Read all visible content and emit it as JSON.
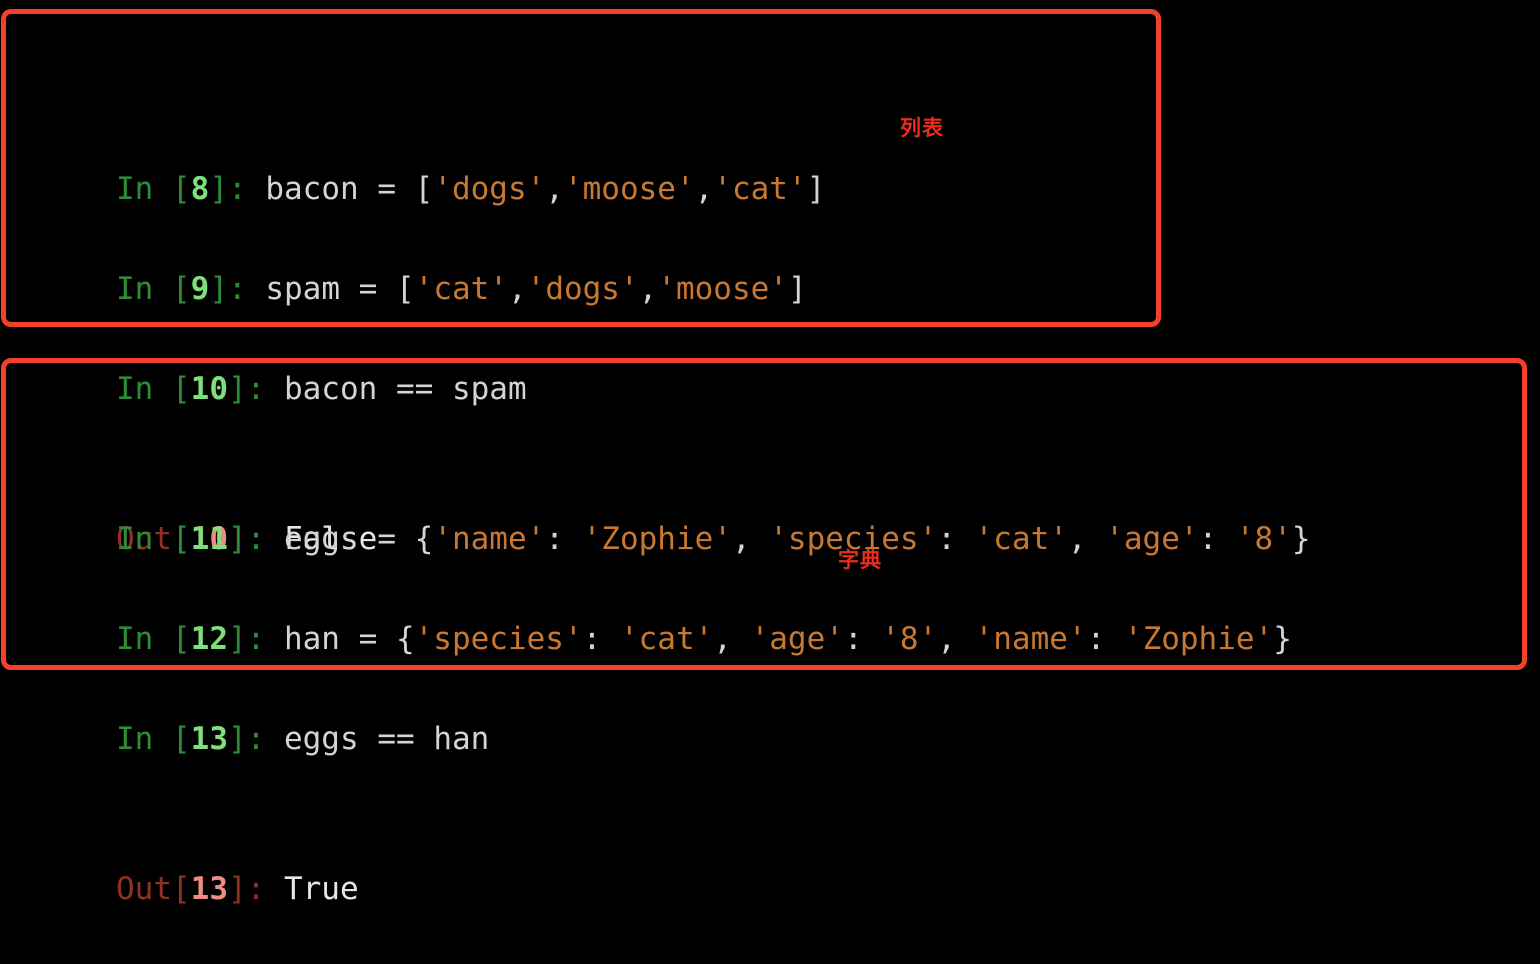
{
  "terminal": {
    "background": "#000000",
    "prompt_in_color": "#2e8b37",
    "prompt_in_num_color": "#7ee07a",
    "prompt_out_color": "#8e3223",
    "prompt_out_num_color": "#f08a84",
    "string_color": "#c87830",
    "punctuation_color": "#d4d4d4",
    "annotation_color": "#ee2b1c",
    "box_border_color": "#f2402a"
  },
  "cells": {
    "c8": {
      "prompt_label": "In ",
      "bracket_open": "[",
      "number": "8",
      "bracket_close": "]: ",
      "var": "bacon ",
      "op": "= ",
      "open": "[",
      "s1": "'dogs'",
      "comma1": ",",
      "s2": "'moose'",
      "comma2": ",",
      "s3": "'cat'",
      "close": "]"
    },
    "c9": {
      "prompt_label": "In ",
      "bracket_open": "[",
      "number": "9",
      "bracket_close": "]: ",
      "var": "spam ",
      "op": "= ",
      "open": "[",
      "s1": "'cat'",
      "comma1": ",",
      "s2": "'dogs'",
      "comma2": ",",
      "s3": "'moose'",
      "close": "]"
    },
    "c10": {
      "prompt_label": "In ",
      "bracket_open": "[",
      "number": "10",
      "bracket_close": "]: ",
      "expr_left": "bacon ",
      "expr_op": "== ",
      "expr_right": "spam",
      "out_label": "Out",
      "out_bracket_open": "[",
      "out_number": "10",
      "out_bracket_close": "]: ",
      "out_value": "False"
    },
    "c11": {
      "prompt_label": "In ",
      "bracket_open": "[",
      "number": "11",
      "bracket_close": "]: ",
      "var": "eggs ",
      "op": "= ",
      "open": "{",
      "k1": "'name'",
      "colon1": ": ",
      "v1": "'Zophie'",
      "comma1": ", ",
      "k2": "'species'",
      "colon2": ": ",
      "v2": "'cat'",
      "comma2": ", ",
      "k3": "'age'",
      "colon3": ": ",
      "v3": "'8'",
      "close": "}"
    },
    "c12": {
      "prompt_label": "In ",
      "bracket_open": "[",
      "number": "12",
      "bracket_close": "]: ",
      "var": "han ",
      "op": "= ",
      "open": "{",
      "k1": "'species'",
      "colon1": ": ",
      "v1": "'cat'",
      "comma1": ", ",
      "k2": "'age'",
      "colon2": ": ",
      "v2": "'8'",
      "comma2": ", ",
      "k3": "'name'",
      "colon3": ": ",
      "v3": "'Zophie'",
      "close": "}"
    },
    "c13": {
      "prompt_label": "In ",
      "bracket_open": "[",
      "number": "13",
      "bracket_close": "]: ",
      "expr_left": "eggs ",
      "expr_op": "== ",
      "expr_right": "han",
      "out_label": "Out",
      "out_bracket_open": "[",
      "out_number": "13",
      "out_bracket_close": "]: ",
      "out_value": "True"
    }
  },
  "annotations": {
    "list_label": "列表",
    "dict_label": "字典"
  }
}
